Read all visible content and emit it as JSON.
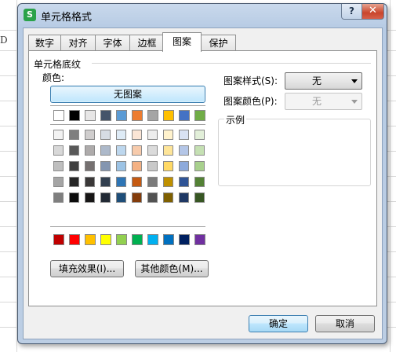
{
  "dialog": {
    "title": "单元格格式",
    "app_icon": "S",
    "help_label": "?",
    "close_label": "✕",
    "tabs": [
      {
        "label": "数字"
      },
      {
        "label": "对齐"
      },
      {
        "label": "字体"
      },
      {
        "label": "边框"
      },
      {
        "label": "图案",
        "active": true
      },
      {
        "label": "保护"
      }
    ],
    "group_label": "单元格底纹",
    "color_label": "颜色:",
    "no_pattern_label": "无图案",
    "fill_effects_label": "填充效果(I)...",
    "more_colors_label": "其他颜色(M)...",
    "pattern_style_label": "图案样式(S):",
    "pattern_style_value": "无",
    "pattern_color_label": "图案颜色(P):",
    "pattern_color_value": "无",
    "sample_label": "示例",
    "ok_label": "确定",
    "cancel_label": "取消"
  },
  "sheet": {
    "column_header": "D"
  },
  "palette": {
    "theme_row": [
      "#ffffff",
      "#000000",
      "#e7e6e6",
      "#44546a",
      "#5b9bd5",
      "#ed7d31",
      "#a5a5a5",
      "#ffc000",
      "#4472c4",
      "#70ad47"
    ],
    "tint_rows": [
      [
        "#f2f2f2",
        "#7f7f7f",
        "#d0cece",
        "#d6dce4",
        "#deebf6",
        "#fbe5d5",
        "#ededed",
        "#fff2cc",
        "#d9e2f3",
        "#e2efd9"
      ],
      [
        "#d8d8d8",
        "#595959",
        "#aeabab",
        "#adb9ca",
        "#bdd7ee",
        "#f7cbac",
        "#dbdbdb",
        "#fee599",
        "#b4c6e7",
        "#c5e0b3"
      ],
      [
        "#bfbfbf",
        "#3f3f3f",
        "#757070",
        "#8496b0",
        "#9cc3e5",
        "#f4b183",
        "#c9c9c9",
        "#ffd965",
        "#8eaadb",
        "#a8d08d"
      ],
      [
        "#a5a5a5",
        "#262626",
        "#3a3838",
        "#323f4f",
        "#2e75b5",
        "#c55a11",
        "#7b7b7b",
        "#bf9000",
        "#2f5496",
        "#538135"
      ],
      [
        "#7f7f7f",
        "#0c0c0c",
        "#171616",
        "#222a35",
        "#1e4e79",
        "#833c0b",
        "#525252",
        "#7f6000",
        "#1f3864",
        "#375623"
      ]
    ],
    "standard_row": [
      "#c00000",
      "#ff0000",
      "#ffc000",
      "#ffff00",
      "#92d050",
      "#00b050",
      "#00b0f0",
      "#0070c0",
      "#002060",
      "#7030a0"
    ]
  }
}
